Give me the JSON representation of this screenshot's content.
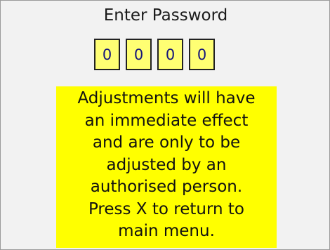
{
  "screen": {
    "title": "Enter Password"
  },
  "password": {
    "digits": [
      "0",
      "0",
      "0",
      "0"
    ]
  },
  "warning": {
    "lines": [
      "Adjustments will have",
      "an immediate effect",
      "and are only to be",
      "adjusted by an",
      "authorised person.",
      "Press X to return to",
      "main menu."
    ]
  },
  "colors": {
    "background": "#f2f2f2",
    "digit_box": "#ffff73",
    "digit_text": "#15157a",
    "warning_bg": "#ffff00"
  }
}
